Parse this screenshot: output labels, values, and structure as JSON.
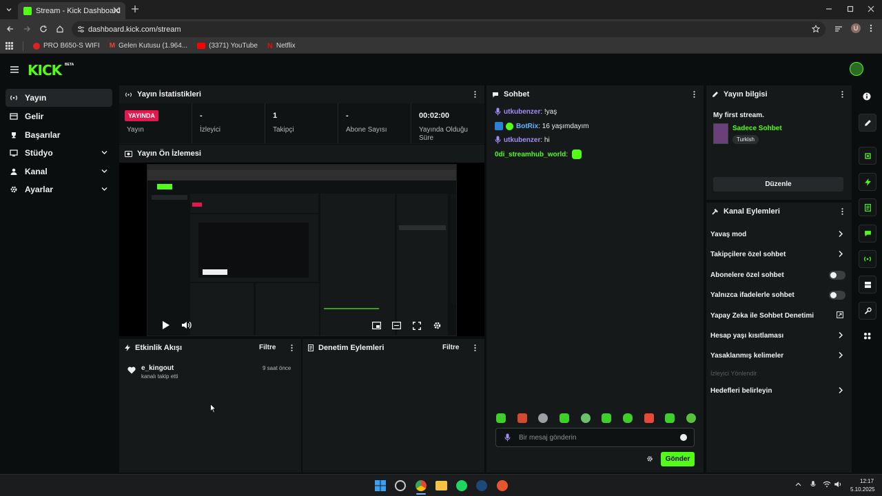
{
  "browser": {
    "tab_title": "Stream - Kick Dashboard",
    "url": "dashboard.kick.com/stream",
    "bookmarks": [
      {
        "label": "PRO B650-S WIFI",
        "icon": "msi-icon"
      },
      {
        "label": "Gelen Kutusu (1.964...",
        "icon": "gmail-icon"
      },
      {
        "label": "(3371) YouTube",
        "icon": "youtube-icon"
      },
      {
        "label": "Netflix",
        "icon": "netflix-icon"
      }
    ],
    "profile_initial": "U"
  },
  "brand": {
    "logo": "KICK",
    "badge": "BETA",
    "accent": "#53fc18"
  },
  "sidebar": {
    "items": [
      {
        "label": "Yayın",
        "icon": "broadcast-icon",
        "active": true
      },
      {
        "label": "Gelir",
        "icon": "revenue-icon"
      },
      {
        "label": "Başarılar",
        "icon": "trophy-icon"
      },
      {
        "label": "Stüdyo",
        "icon": "studio-icon",
        "expandable": true
      },
      {
        "label": "Kanal",
        "icon": "user-icon",
        "expandable": true
      },
      {
        "label": "Ayarlar",
        "icon": "gear-icon",
        "expandable": true
      }
    ]
  },
  "stats": {
    "title": "Yayın İstatistikleri",
    "live_badge": "YAYINDA",
    "items": [
      {
        "value": "",
        "label": "Yayın"
      },
      {
        "value": "-",
        "label": "İzleyici"
      },
      {
        "value": "1",
        "label": "Takipçi"
      },
      {
        "value": "-",
        "label": "Abone Sayısı"
      },
      {
        "value": "00:02:00",
        "label": "Yayında Olduğu Süre"
      }
    ]
  },
  "preview": {
    "title": "Yayın Ön İzlemesi"
  },
  "activity": {
    "title": "Etkinlik Akışı",
    "filter": "Filtre",
    "events": [
      {
        "user": "e_kingout",
        "text": "kanalı takip etti",
        "time": "9 saat önce"
      }
    ]
  },
  "moderation": {
    "title": "Denetim Eylemleri",
    "filter": "Filtre"
  },
  "chat": {
    "title": "Sohbet",
    "messages": [
      {
        "user": "utkubenzer",
        "text": "!yaş",
        "color": "purple"
      },
      {
        "user": "BotRix",
        "text": "16 yaşımdayım",
        "color": "blue"
      },
      {
        "user": "utkubenzer",
        "text": "hi",
        "color": "purple"
      },
      {
        "user": "0di_streamhub_world",
        "text": "",
        "color": "green"
      }
    ],
    "input_placeholder": "Bir mesaj gönderin",
    "send_label": "Gönder"
  },
  "stream_info": {
    "title": "Yayın bilgisi",
    "stream_title": "My first stream.",
    "category": "Sadece Sohbet",
    "language": "Turkish",
    "edit_label": "Düzenle"
  },
  "channel_actions": {
    "title": "Kanal Eylemleri",
    "items": [
      {
        "label": "Yavaş mod",
        "control": "chevron"
      },
      {
        "label": "Takipçilere özel sohbet",
        "control": "chevron"
      },
      {
        "label": "Abonelere özel sohbet",
        "control": "toggle"
      },
      {
        "label": "Yalnızca ifadelerle sohbet",
        "control": "toggle"
      },
      {
        "label": "Yapay Zeka ile Sohbet Denetimi",
        "control": "external"
      },
      {
        "label": "Hesap yaşı kısıtlaması",
        "control": "chevron"
      },
      {
        "label": "Yasaklanmış kelimeler",
        "control": "chevron"
      },
      {
        "label": "İzleyici Yönlendir",
        "control": "disabled"
      },
      {
        "label": "Hedefleri belirleyin",
        "control": "chevron"
      }
    ]
  },
  "taskbar": {
    "time": "12:17",
    "date": "5.10.2025"
  }
}
